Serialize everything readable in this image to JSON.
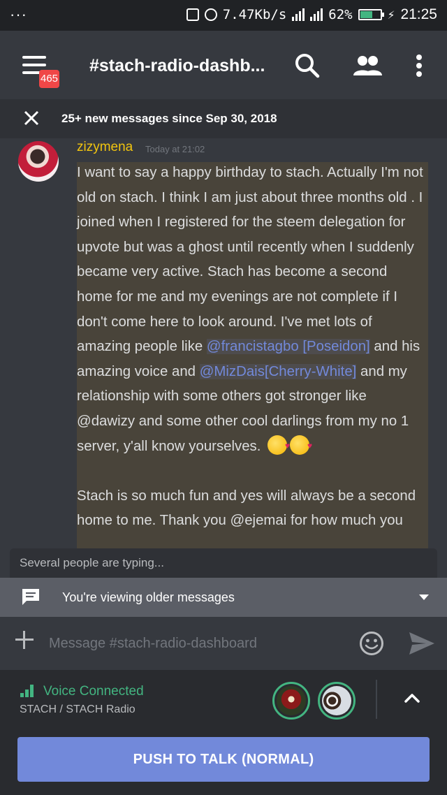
{
  "status_bar": {
    "dots": "···",
    "network_speed": "7.47Kb/s",
    "battery_percent": "62%",
    "battery_level": 0.62,
    "time": "21:25"
  },
  "header": {
    "unread_badge": "465",
    "channel_title": "#stach-radio-dashb..."
  },
  "new_messages_bar": {
    "text": "25+ new messages since Sep 30, 2018"
  },
  "message": {
    "author": "zizymena",
    "author_color": "#f1c40f",
    "timestamp": "Today at 21:02",
    "p1_a": "I want to say a happy birthday to stach. Actually I'm not old on stach. I think I am just about three months old . I joined when I registered for the steem delegation for upvote but was a ghost until recently when I suddenly became very active. Stach has become a second home for me and my evenings are not complete if I don't come here to look around. I've met lots of amazing people like ",
    "mention1": "@francistagbo [Poseidon]",
    "p1_b": " and his amazing voice and ",
    "mention2": "@MizDais[Cherry-White]",
    "p1_c": " and my relationship with some others got stronger like @dawizy  and some other cool darlings from my no 1 server, y'all know yourselves.",
    "emoji": "kissing-heart",
    "p2": "Stach is so much fun and yes will always be a second home to me. Thank you @ejemai for how much you"
  },
  "typing_indicator": "Several people are typing...",
  "older_messages_bar": {
    "text": "You're viewing older messages"
  },
  "composer": {
    "placeholder": "Message #stach-radio-dashboard"
  },
  "voice": {
    "status": "Voice Connected",
    "channel": "STACH / STACH Radio",
    "status_color": "#43b581"
  },
  "push_to_talk": "PUSH TO TALK (NORMAL)",
  "colors": {
    "background": "#36393f",
    "accent": "#7289da",
    "badge": "#f04747",
    "highlight": "#49443a"
  }
}
